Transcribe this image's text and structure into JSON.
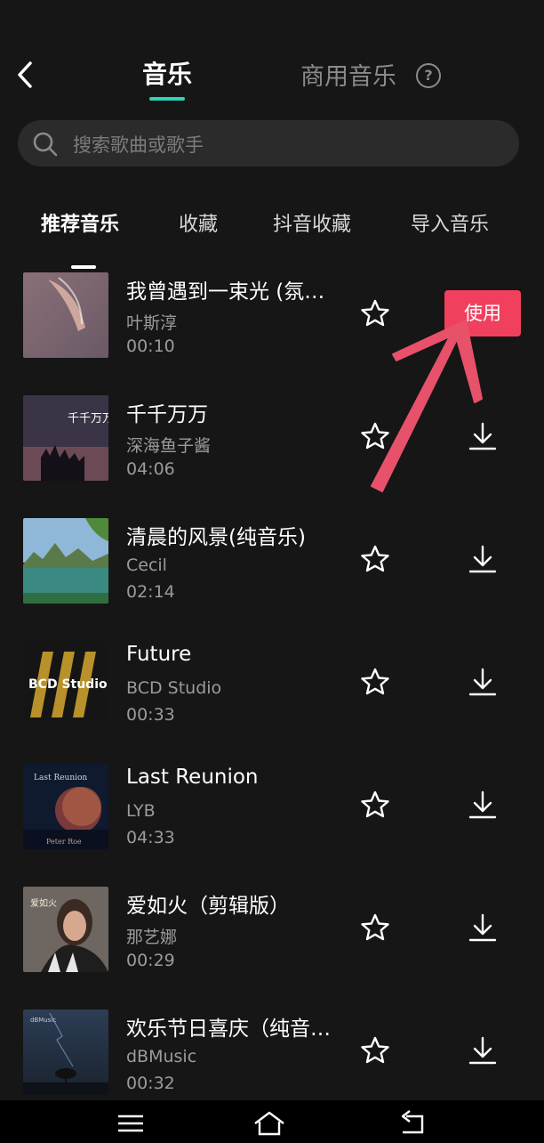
{
  "header": {
    "tab_music": "音乐",
    "tab_commercial": "商用音乐",
    "help_glyph": "?",
    "accent_color": "#2ed3b9"
  },
  "search": {
    "placeholder": "搜索歌曲或歌手"
  },
  "subtabs": [
    {
      "label": "推荐音乐",
      "active": true
    },
    {
      "label": "收藏",
      "active": false
    },
    {
      "label": "抖音收藏",
      "active": false
    },
    {
      "label": "导入音乐",
      "active": false
    }
  ],
  "songs": [
    {
      "title": "我曾遇到一束光 (氛…",
      "artist": "叶斯淳",
      "duration": "00:10",
      "action": "use",
      "action_label": "使用"
    },
    {
      "title": "千千万万",
      "artist": "深海鱼子酱",
      "duration": "04:06",
      "action": "download"
    },
    {
      "title": "清晨的风景(纯音乐)",
      "artist": "Cecil",
      "duration": "02:14",
      "action": "download"
    },
    {
      "title": "Future",
      "artist": "BCD Studio",
      "duration": "00:33",
      "action": "download"
    },
    {
      "title": "Last Reunion",
      "artist": "LYB",
      "duration": "04:33",
      "action": "download"
    },
    {
      "title": "爱如火（剪辑版）",
      "artist": "那艺娜",
      "duration": "00:29",
      "action": "download"
    },
    {
      "title": "欢乐节日喜庆（纯音…",
      "artist": "dBMusic",
      "duration": "00:32",
      "action": "download"
    }
  ],
  "cover_art_text": {
    "song2": "千千万万",
    "song4": "BCD Studio",
    "song5_top": "Last Reunion",
    "song5_bottom": "Peter Roe",
    "song6": "爱如火",
    "song7": "dBMusic"
  },
  "colors": {
    "use_button": "#f0405d",
    "annotation_arrow": "#e8516a",
    "background": "#161616"
  },
  "icons": {
    "back": "chevron-left-icon",
    "help": "question-circle-icon",
    "search": "search-icon",
    "favorite": "star-outline-icon",
    "download": "download-icon",
    "nav_menu": "menu-icon",
    "nav_home": "home-icon",
    "nav_back": "return-icon"
  }
}
